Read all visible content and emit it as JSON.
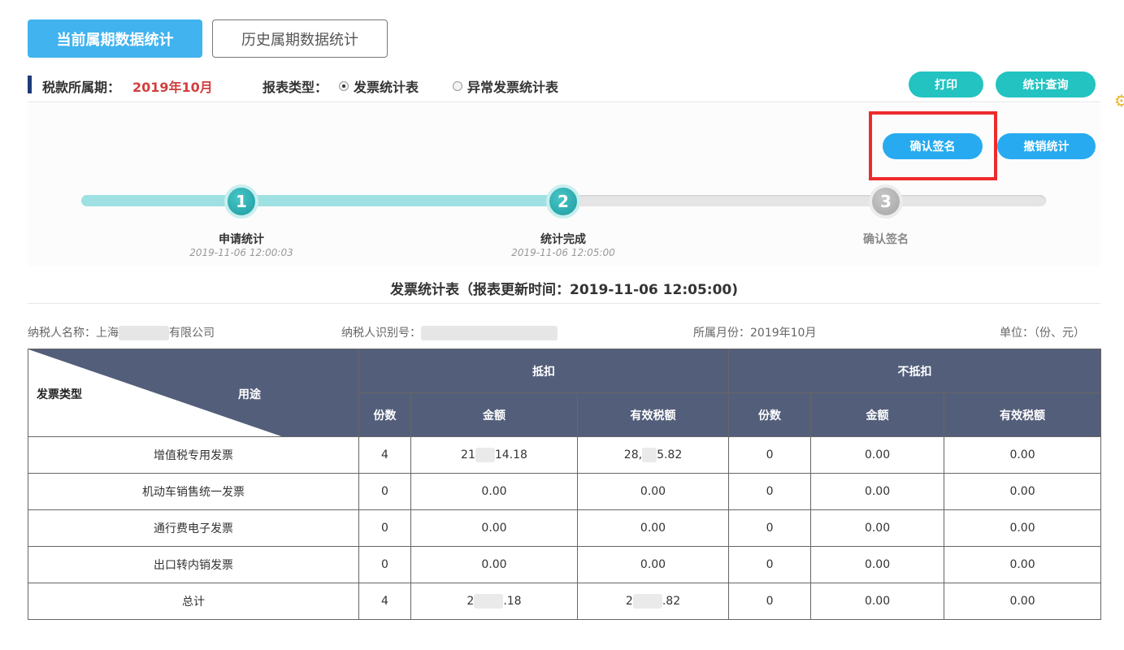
{
  "tabs": {
    "current": "当前属期数据统计",
    "history": "历史属期数据统计"
  },
  "filter": {
    "period_label": "税款所属期：",
    "period_value": "2019年10月",
    "report_type_label": "报表类型：",
    "options": [
      "发票统计表",
      "异常发票统计表"
    ],
    "selected": "发票统计表"
  },
  "actions": {
    "print": "打印",
    "query": "统计查询",
    "confirm_sign": "确认签名",
    "cancel_stats": "撤销统计"
  },
  "steps": [
    {
      "num": "1",
      "label": "申请统计",
      "time": "2019-11-06 12:00:03",
      "status": "done"
    },
    {
      "num": "2",
      "label": "统计完成",
      "time": "2019-11-06 12:05:00",
      "status": "done"
    },
    {
      "num": "3",
      "label": "确认签名",
      "time": "",
      "status": "pending"
    }
  ],
  "progress_fraction": 0.5,
  "report": {
    "title": "发票统计表（报表更新时间：2019-11-06 12:05:00)"
  },
  "info": {
    "taxpayer_name_label": "纳税人名称：",
    "taxpayer_name_prefix": "上海",
    "taxpayer_name_suffix": "有限公司",
    "taxpayer_id_label": "纳税人识别号：",
    "month_label": "所属月份：",
    "month_value": "2019年10月",
    "unit_label": "单位：（份、元）"
  },
  "table": {
    "corner_type": "发票类型",
    "corner_use": "用途",
    "group_deduct": "抵扣",
    "group_nodeduct": "不抵扣",
    "col_count": "份数",
    "col_amount": "金额",
    "col_tax": "有效税额",
    "rows": [
      {
        "type": "增值税专用发票",
        "d_count": "4",
        "d_amount_a": "21",
        "d_amount_b": "14.18",
        "d_tax_a": "28,",
        "d_tax_b": "5.82",
        "n_count": "0",
        "n_amount": "0.00",
        "n_tax": "0.00"
      },
      {
        "type": "机动车销售统一发票",
        "d_count": "0",
        "d_amount": "0.00",
        "d_tax": "0.00",
        "n_count": "0",
        "n_amount": "0.00",
        "n_tax": "0.00"
      },
      {
        "type": "通行费电子发票",
        "d_count": "0",
        "d_amount": "0.00",
        "d_tax": "0.00",
        "n_count": "0",
        "n_amount": "0.00",
        "n_tax": "0.00"
      },
      {
        "type": "出口转内销发票",
        "d_count": "0",
        "d_amount": "0.00",
        "d_tax": "0.00",
        "n_count": "0",
        "n_amount": "0.00",
        "n_tax": "0.00"
      },
      {
        "type": "总计",
        "d_count": "4",
        "d_amount_a": "2",
        "d_amount_b": ".18",
        "d_tax_a": "2",
        "d_tax_b": ".82",
        "n_count": "0",
        "n_amount": "0.00",
        "n_tax": "0.00"
      }
    ]
  },
  "colors": {
    "primary": "#41b3ef",
    "teal": "#22c3c0",
    "header": "#535e7a",
    "period_red": "#d23f3f",
    "highlight": "#ee2a2a"
  }
}
